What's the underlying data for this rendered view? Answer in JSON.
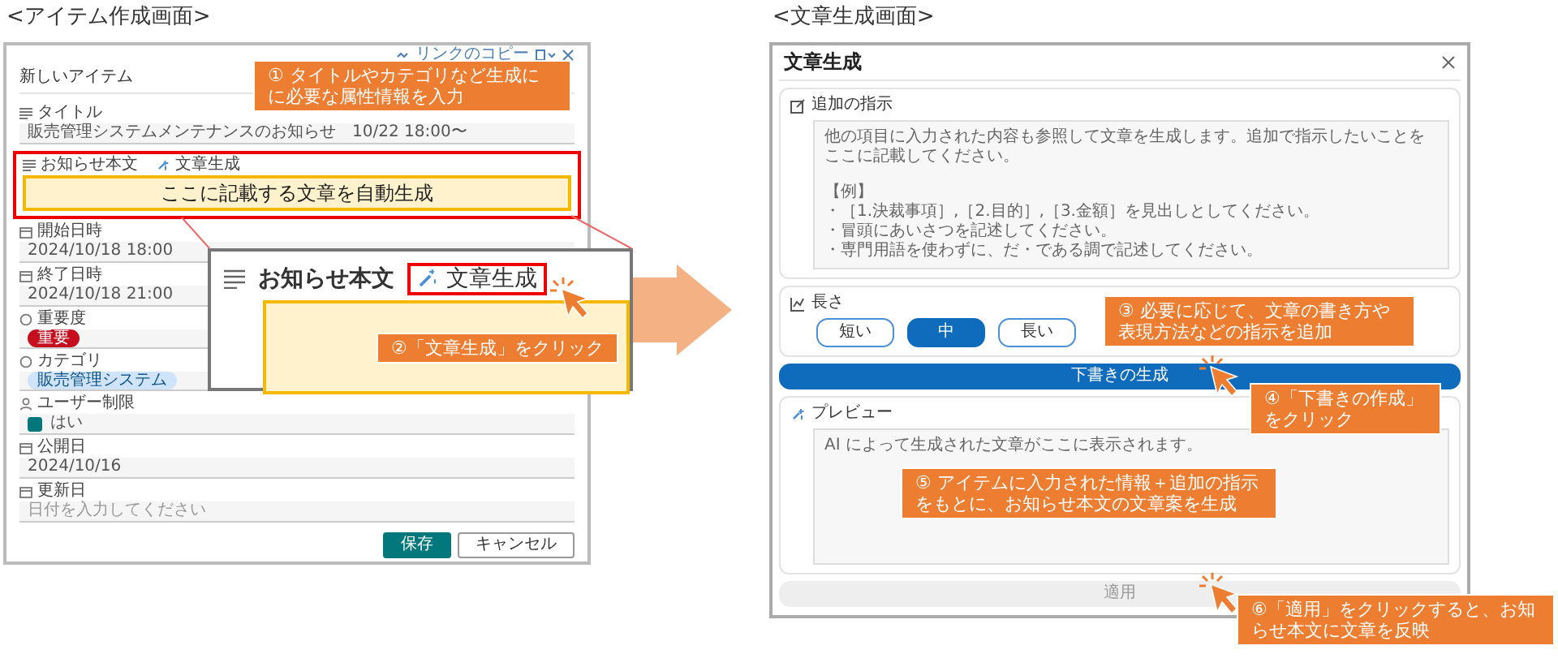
{
  "item_screen": {
    "heading": "<アイテム作成画面>",
    "panel": {
      "toolbar": {
        "copy_link": "リンクのコピー"
      },
      "title": "新しいアイテム",
      "fields": [
        {
          "kind": "text",
          "label": "タイトル",
          "value": "販売管理システムメンテナンスのお知らせ　10/22 18:00〜"
        },
        {
          "kind": "body",
          "label": "お知らせ本文",
          "action": "文章生成",
          "note": "ここに記載する文章を自動生成"
        },
        {
          "kind": "date",
          "label": "開始日時",
          "value": "2024/10/18 18:00"
        },
        {
          "kind": "date",
          "label": "終了日時",
          "value": "2024/10/18 21:00"
        },
        {
          "kind": "choice",
          "label": "重要度",
          "tag": "重要",
          "color": "#c50f1f"
        },
        {
          "kind": "choice",
          "label": "カテゴリ",
          "tag": "販売管理システム",
          "color": "#cfe4fa"
        },
        {
          "kind": "checkbox",
          "label": "ユーザー制限",
          "text": "はい",
          "checked": true
        },
        {
          "kind": "date",
          "label": "公開日",
          "value": "2024/10/16"
        },
        {
          "kind": "date",
          "label": "更新日",
          "placeholder": "日付を入力してください"
        }
      ],
      "buttons": [
        {
          "label": "保存",
          "primary": true
        },
        {
          "label": "キャンセル",
          "primary": false
        }
      ]
    },
    "callout": "① タイトルやカテゴリなど生成にに必要な属性情報を入力",
    "zoom": {
      "label": "お知らせ本文",
      "action": "文章生成",
      "callout": "②「文章生成」をクリック"
    }
  },
  "generate_screen": {
    "heading": "<文章生成画面>",
    "dialog": {
      "title": "文章生成",
      "instructions": {
        "label": "追加の指示",
        "lines": [
          "他の項目に入力された内容も参照して文章を生成します。追加で指示したいことをここに記載してください。",
          "【例】",
          "・［1.決裁事項］,［2.目的］,［3.金額］を見出しとしてください。",
          "・冒頭にあいさつを記述してください。",
          "・専門用語を使わずに、だ・である調で記述してください。"
        ]
      },
      "length": {
        "label": "長さ",
        "options": [
          {
            "label": "短い",
            "selected": false
          },
          {
            "label": "中",
            "selected": true
          },
          {
            "label": "長い",
            "selected": false
          }
        ]
      },
      "generate_button": "下書きの生成",
      "preview": {
        "label": "プレビュー",
        "text": "AI によって生成された文章がここに表示されます。"
      },
      "apply_button": {
        "label": "適用",
        "disabled": true
      }
    },
    "callouts": [
      "③ 必要に応じて、文章の書き方や表現方法などの指示を追加",
      "④「下書きの作成」をクリック",
      "⑤ アイテムに入力された情報＋追加の指示をもとに、お知らせ本文の文章案を生成",
      "⑥「適用」をクリックすると、お知らせ本文に文章を反映"
    ]
  }
}
